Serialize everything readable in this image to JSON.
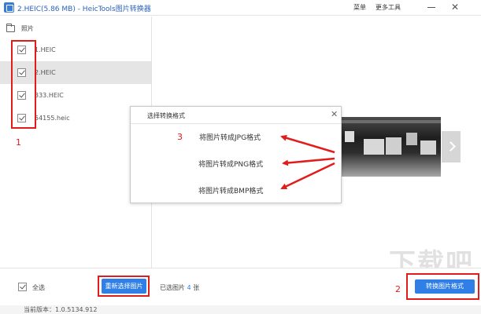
{
  "window": {
    "title": "2.HEIC(5.86 MB) - HeicTools图片转换器",
    "menu_main": "菜单",
    "menu_tools": "更多工具",
    "close_glyph": "✕"
  },
  "sidebar": {
    "folder_label": "照片",
    "files": [
      {
        "name": "1.HEIC",
        "checked": true,
        "selected": false
      },
      {
        "name": "2.HEIC",
        "checked": true,
        "selected": true
      },
      {
        "name": "333.HEIC",
        "checked": true,
        "selected": false
      },
      {
        "name": "54155.heic",
        "checked": true,
        "selected": false
      }
    ]
  },
  "bottom": {
    "select_all_label": "全选",
    "reselect_label": "重新选择图片",
    "selected_prefix": "已选图片",
    "selected_count": "4",
    "selected_suffix": "张",
    "convert_label": "转换图片格式"
  },
  "status": {
    "version": "当前版本：1.0.5134.912"
  },
  "dialog": {
    "title": "选择转换格式",
    "close_glyph": "✕",
    "options": [
      "将图片转成JPG格式",
      "将图片转成PNG格式",
      "将图片转成BMP格式"
    ]
  },
  "annotations": {
    "step1": "1",
    "step2": "2",
    "step3": "3",
    "color": "#e21b1b"
  },
  "watermark": {
    "text": "下载吧"
  },
  "colors": {
    "accent": "#2f7fe6",
    "title_text": "#2c62c0"
  }
}
